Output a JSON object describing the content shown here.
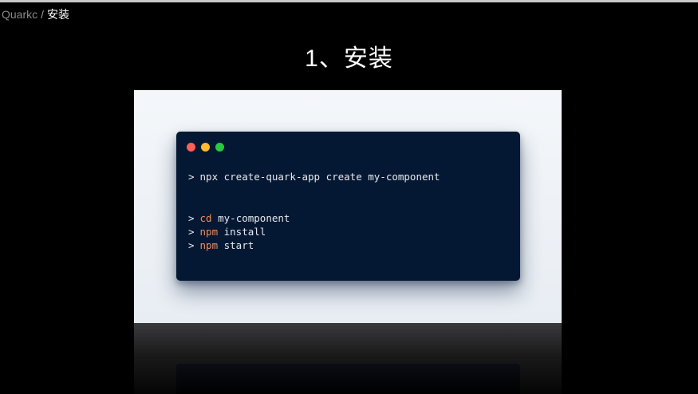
{
  "breadcrumb": {
    "root": "Quarkc",
    "separator": "/",
    "current": "安装"
  },
  "slide": {
    "title": "1、安装"
  },
  "terminal": {
    "window_controls": [
      "close",
      "minimize",
      "maximize"
    ],
    "lines": [
      {
        "prompt": ">",
        "command": "",
        "args": "npx create-quark-app create my-component"
      },
      {
        "prompt": ">",
        "command": "cd",
        "args": " my-component"
      },
      {
        "prompt": ">",
        "command": "npm",
        "args": " install"
      },
      {
        "prompt": ">",
        "command": "npm",
        "args": " start"
      }
    ]
  },
  "colors": {
    "terminal_bg": "#051833",
    "command_accent": "#f08c5a",
    "close_dot": "#fe5f57",
    "minimize_dot": "#febc2e",
    "maximize_dot": "#28c840"
  }
}
